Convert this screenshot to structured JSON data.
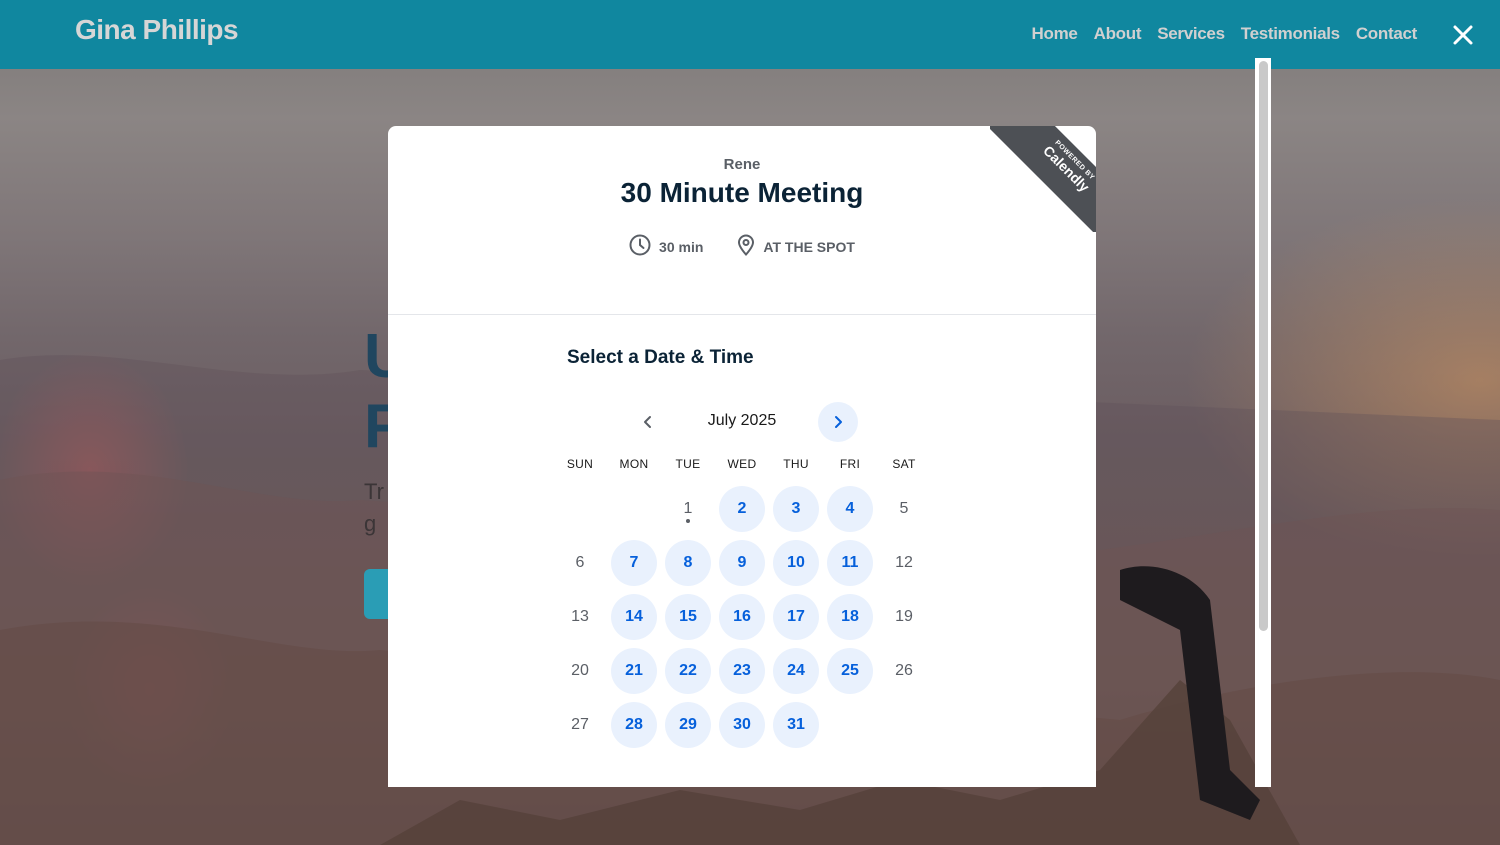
{
  "site": {
    "brand": "Gina Phillips",
    "nav": [
      "Home",
      "About",
      "Services",
      "Testimonials",
      "Contact"
    ],
    "hero": {
      "line1": "U",
      "line2": "F",
      "para1": "Tr",
      "para2": "g"
    }
  },
  "overlay": {
    "close_icon": "close-icon"
  },
  "calendly": {
    "ribbon_small": "POWERED BY",
    "ribbon_brand": "Calendly",
    "host": "Rene",
    "event_title": "30 Minute Meeting",
    "duration": "30 min",
    "location": "AT THE SPOT",
    "select_title": "Select a Date & Time",
    "month": "July 2025",
    "weekdays": [
      "SUN",
      "MON",
      "TUE",
      "WED",
      "THU",
      "FRI",
      "SAT"
    ],
    "weeks": [
      [
        {
          "d": ""
        },
        {
          "d": ""
        },
        {
          "d": "1",
          "today": true
        },
        {
          "d": "2",
          "a": true
        },
        {
          "d": "3",
          "a": true
        },
        {
          "d": "4",
          "a": true
        },
        {
          "d": "5"
        }
      ],
      [
        {
          "d": "6"
        },
        {
          "d": "7",
          "a": true
        },
        {
          "d": "8",
          "a": true
        },
        {
          "d": "9",
          "a": true
        },
        {
          "d": "10",
          "a": true
        },
        {
          "d": "11",
          "a": true
        },
        {
          "d": "12"
        }
      ],
      [
        {
          "d": "13"
        },
        {
          "d": "14",
          "a": true
        },
        {
          "d": "15",
          "a": true
        },
        {
          "d": "16",
          "a": true
        },
        {
          "d": "17",
          "a": true
        },
        {
          "d": "18",
          "a": true
        },
        {
          "d": "19"
        }
      ],
      [
        {
          "d": "20"
        },
        {
          "d": "21",
          "a": true
        },
        {
          "d": "22",
          "a": true
        },
        {
          "d": "23",
          "a": true
        },
        {
          "d": "24",
          "a": true
        },
        {
          "d": "25",
          "a": true
        },
        {
          "d": "26"
        }
      ],
      [
        {
          "d": "27"
        },
        {
          "d": "28",
          "a": true
        },
        {
          "d": "29",
          "a": true
        },
        {
          "d": "30",
          "a": true
        },
        {
          "d": "31",
          "a": true
        },
        {
          "d": ""
        },
        {
          "d": ""
        }
      ]
    ]
  },
  "colors": {
    "navbar": "#10879f",
    "accent": "#0660db",
    "available_bg": "#e9f1fd",
    "title": "#0b2336"
  }
}
